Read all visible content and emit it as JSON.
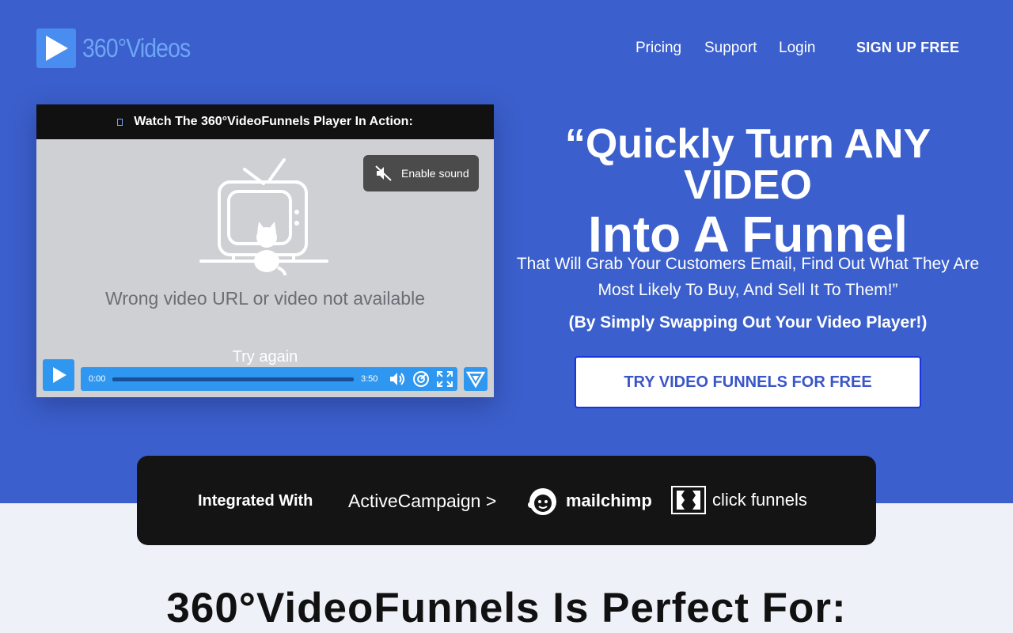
{
  "brand": {
    "name": "360°Videos",
    "logo_icon": "play-icon",
    "logo_color": "#4a8df0"
  },
  "nav": {
    "items": [
      {
        "label": "Pricing"
      },
      {
        "label": "Support"
      },
      {
        "label": "Login"
      }
    ],
    "signup_label": "SIGN UP FREE"
  },
  "player": {
    "header": "Watch The 360°VideoFunnels Player In Action:",
    "sound_button": "Enable sound",
    "error_text": "Wrong video URL or video not available",
    "retry": "Try again",
    "time_current": "0:00",
    "time_total": "3:50",
    "accent": "#2f97ef"
  },
  "hero": {
    "headline_line1": "“Quickly Turn ANY VIDEO",
    "headline_line2": "Into A Funnel",
    "subheadline": "That Will Grab Your Customers Email, Find Out What They Are Most Likely To Buy, And Sell It To Them!”",
    "subheadline_bold": "(By Simply Swapping Out Your Video Player!)",
    "cta_label": "TRY VIDEO FUNNELS FOR FREE",
    "background": "#3b5fcc"
  },
  "integrations": {
    "label": "Integrated With",
    "partners": [
      "ActiveCampaign >",
      "mailchimp",
      "click funnels"
    ]
  },
  "section": {
    "title": "360°VideoFunnels Is Perfect For:"
  }
}
